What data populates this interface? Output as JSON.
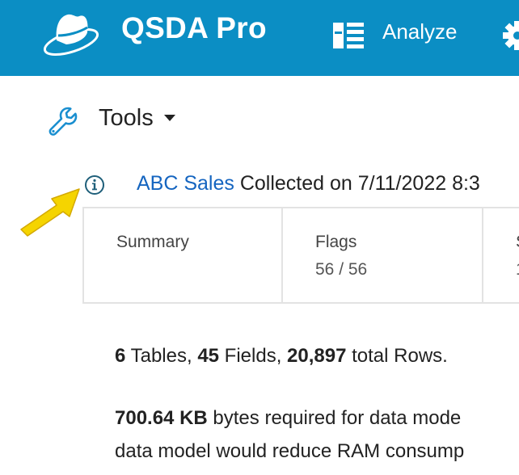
{
  "header": {
    "app_title": "QSDA Pro",
    "analyze_label": "Analyze",
    "logo_icon": "hat-logo-icon",
    "settings_icon": "gear-icon",
    "background": "#0b8ec4"
  },
  "toolbar": {
    "tools_label": "Tools",
    "tools_icon": "wrench-icon"
  },
  "app_info": {
    "app_name": "ABC Sales",
    "collected_text": " Collected on 7/11/2022 8:3",
    "info_icon": "info-circle-icon",
    "pointer_icon": "yellow-arrow-icon"
  },
  "tabs": [
    {
      "label": "Summary",
      "value": ""
    },
    {
      "label": "Flags",
      "value": "56 / 56"
    },
    {
      "label": "S",
      "value": "1"
    }
  ],
  "summary": {
    "tables_count": "6",
    "tables_text": " Tables, ",
    "fields_count": "45",
    "fields_text": " Fields, ",
    "rows_count": "20,897",
    "rows_text": " total Rows.",
    "memory_size": "700.64 KB",
    "memory_text": " bytes required for data mode",
    "memory_text_2": "data model would reduce RAM consump"
  }
}
